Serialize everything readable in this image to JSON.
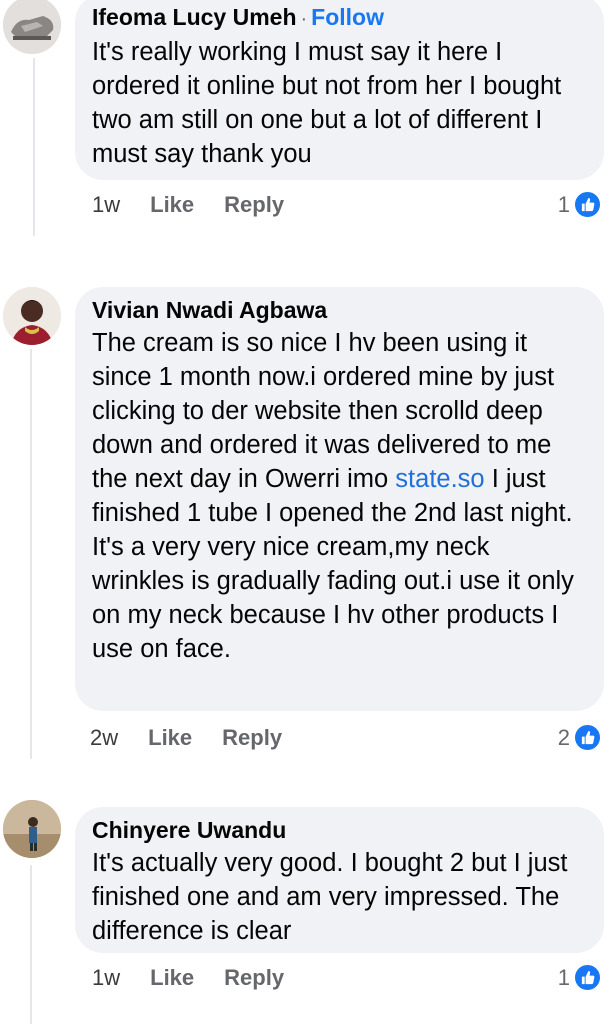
{
  "comments": [
    {
      "author": "Ifeoma Lucy Umeh",
      "separator": "·",
      "follow_label": "Follow",
      "text": "It's really working I must say it here I ordered it online but not from her I bought two am still on one but a lot of different I must say thank you",
      "time": "1w",
      "like_label": "Like",
      "reply_label": "Reply",
      "reaction_count": "1",
      "reaction_icon": "like-icon"
    },
    {
      "author": "Vivian Nwadi Agbawa",
      "text_before_link": "The cream is so nice I hv been using it since 1 month now.i ordered mine by just clicking to der website then  scrolld deep down and ordered it was delivered to me the next day in Owerri imo ",
      "link_text": "state.so",
      "text_after_link": " I just finished 1 tube I opened the 2nd last night.",
      "text_second_paragraph": "It's a very very nice cream,my neck wrinkles is gradually fading out.i use it only on my neck because I hv other products I use on face.",
      "time": "2w",
      "like_label": "Like",
      "reply_label": "Reply",
      "reaction_count": "2",
      "reaction_icon": "like-icon"
    },
    {
      "author": "Chinyere Uwandu",
      "text": "It's actually very good. I bought 2 but I just finished one and am very impressed. The difference is clear",
      "time": "1w",
      "like_label": "Like",
      "reply_label": "Reply",
      "reaction_count": "1",
      "reaction_icon": "like-icon"
    }
  ],
  "colors": {
    "bubble": "#f0f2f5",
    "link": "#1877f2",
    "meta": "#65676b"
  }
}
